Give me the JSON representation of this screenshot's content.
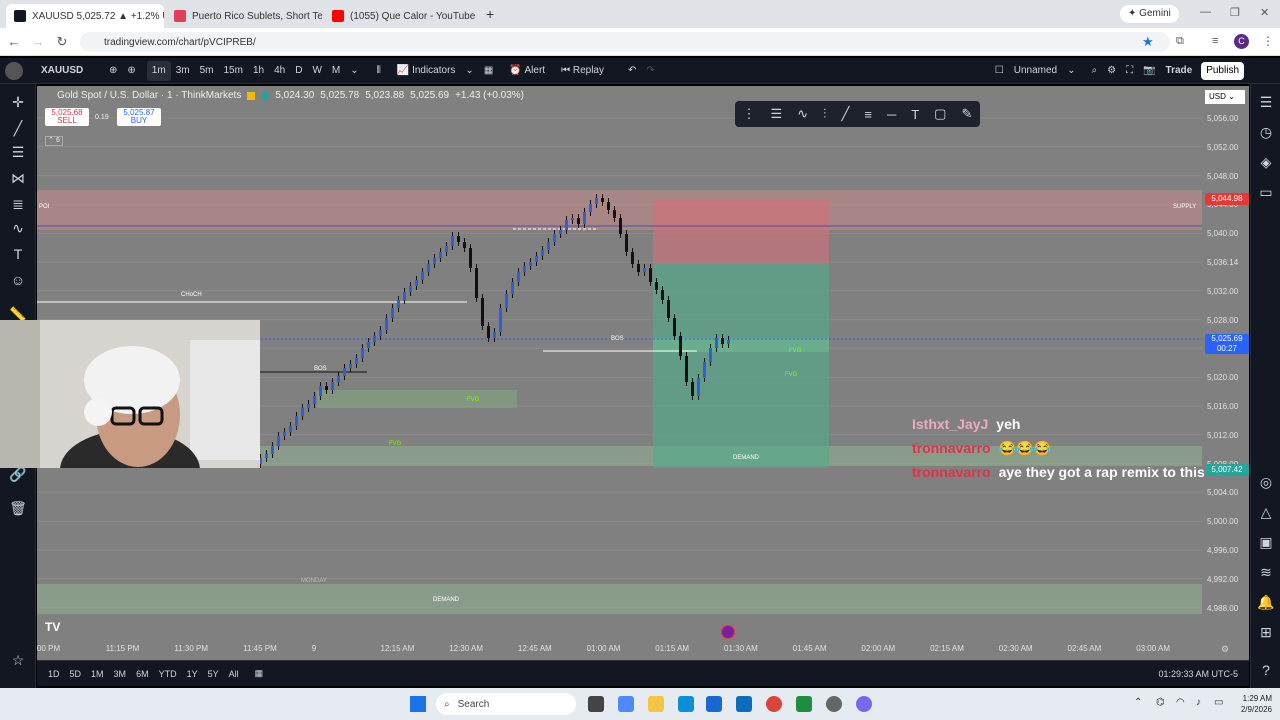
{
  "browser": {
    "tabs": [
      {
        "title": "XAUUSD 5,025.72 ▲ +1.2% Un",
        "active": true,
        "color": "#131722"
      },
      {
        "title": "Puerto Rico Sublets, Short Term",
        "active": false,
        "color": "#e23d5b"
      },
      {
        "title": "(1055) Que Calor - YouTube",
        "active": false,
        "color": "#ff0000"
      }
    ],
    "new_tab": "+",
    "gemini": "Gemini",
    "url": "tradingview.com/chart/pVCIPREB/",
    "profile_initial": "C"
  },
  "toolbar": {
    "symbol": "XAUUSD",
    "timeframes": [
      "1m",
      "3m",
      "5m",
      "15m",
      "1h",
      "4h",
      "D",
      "W",
      "M"
    ],
    "selected_timeframe": "1m",
    "indicators": "Indicators",
    "alert": "Alert",
    "replay": "Replay",
    "layout_name": "Unnamed",
    "trade": "Trade",
    "publish": "Publish"
  },
  "legend": {
    "name": "Gold Spot / U.S. Dollar · 1 · ThinkMarkets",
    "open": "5,024.30",
    "high": "5,025.78",
    "low": "5,023.88",
    "close": "5,025.69",
    "change": "+1.43 (+0.03%)",
    "sell_price": "5,025.68",
    "sell_label": "SELL",
    "spread": "0.19",
    "buy_price": "5,025.87",
    "buy_label": "BUY",
    "indicator_count": "6"
  },
  "currency": "USD",
  "price_labels": {
    "supply": "5,044.98",
    "last": "5,025.69",
    "countdown": "00:27",
    "demand": "5,007.42"
  },
  "zones": {
    "poi": "POI",
    "supply": "SUPPLY",
    "demand": "DEMAND",
    "demand2": "DEMAND",
    "bos": "BOS",
    "choch": "CHoCH",
    "fvg": "FVG",
    "monday": "MONDAY"
  },
  "chart_data": {
    "type": "candlestick",
    "symbol": "XAUUSD",
    "y_ticks": [
      "5,056.00",
      "5,052.00",
      "5,048.00",
      "5,044.00",
      "5,040.00",
      "5,036.14",
      "5,032.00",
      "5,028.00",
      "5,024.00",
      "5,020.00",
      "5,016.00",
      "5,012.00",
      "5,008.00",
      "5,004.00",
      "5,000.00",
      "4,996.00",
      "4,992.00",
      "4,988.00"
    ],
    "x_ticks": [
      "00 PM",
      "11:15 PM",
      "11:30 PM",
      "11:45 PM",
      "9",
      "12:15 AM",
      "12:30 AM",
      "12:45 AM",
      "01:00 AM",
      "01:15 AM",
      "01:30 AM",
      "01:45 AM",
      "02:00 AM",
      "02:15 AM",
      "02:30 AM",
      "02:45 AM",
      "03:00 AM"
    ],
    "ylim": [
      4986,
      5058
    ]
  },
  "chat": [
    {
      "user": "Isthxt_JayJ",
      "msg": "yeh",
      "color": "#f2a7c3"
    },
    {
      "user": "tronnavarro",
      "msg": "😂😂😂",
      "color": "#e0304a"
    },
    {
      "user": "tronnavarro",
      "msg": "aye they got a rap remix to this",
      "color": "#e0304a"
    }
  ],
  "bottom": {
    "ranges": [
      "1D",
      "5D",
      "1M",
      "3M",
      "6M",
      "YTD",
      "1Y",
      "5Y",
      "All"
    ],
    "clock": "01:29:33 AM UTC-5"
  },
  "taskbar": {
    "search": "Search",
    "time": "1:29 AM",
    "date": "2/9/2026"
  }
}
